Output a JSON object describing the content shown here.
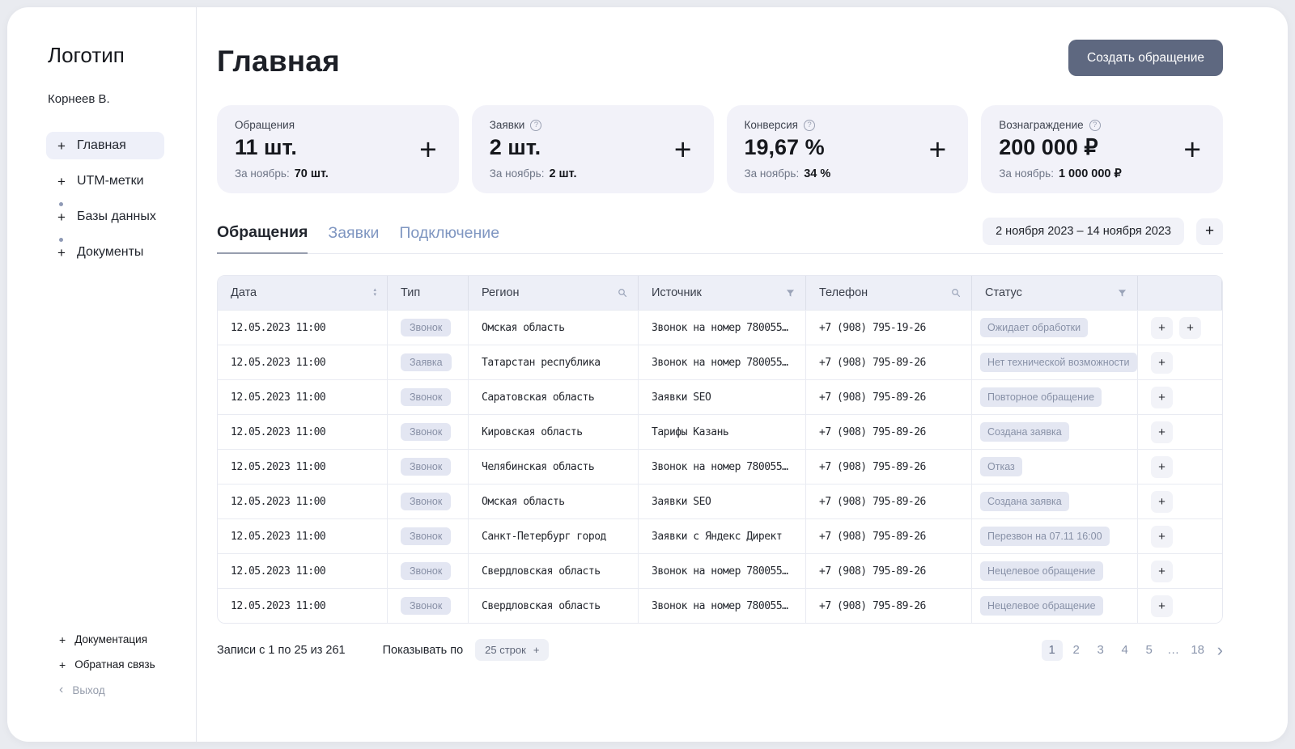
{
  "icons": {
    "plus": "+",
    "question": "?",
    "sort_up": "▴",
    "sort_down": "▾",
    "chevron_left": "‹",
    "chevron_right": "›",
    "ellipsis": "…"
  },
  "sidebar": {
    "logo": "Логотип",
    "user": "Корнеев В.",
    "items": [
      {
        "label": "Главная",
        "active": true
      },
      {
        "label": "UTM-метки"
      },
      {
        "label": "Базы данных",
        "dot": true
      },
      {
        "label": "Документы",
        "dot": true
      }
    ],
    "footer_items": [
      {
        "label": "Документация"
      },
      {
        "label": "Обратная связь"
      }
    ],
    "logout_label": "Выход"
  },
  "header": {
    "title": "Главная",
    "create_button_label": "Создать обращение"
  },
  "stats": [
    {
      "label": "Обращения",
      "help": false,
      "value": "11 шт.",
      "period_label": "За ноябрь:",
      "period_value": "70 шт."
    },
    {
      "label": "Заявки",
      "help": true,
      "value": "2 шт.",
      "period_label": "За ноябрь:",
      "period_value": "2 шт."
    },
    {
      "label": "Конверсия",
      "help": true,
      "value": "19,67 %",
      "period_label": "За ноябрь:",
      "period_value": "34 %"
    },
    {
      "label": "Вознаграждение",
      "help": true,
      "value": "200 000 ₽",
      "period_label": "За ноябрь:",
      "period_value": "1 000 000 ₽"
    }
  ],
  "tabs": [
    {
      "label": "Обращения",
      "active": true
    },
    {
      "label": "Заявки"
    },
    {
      "label": "Подключение"
    }
  ],
  "date_range": "2 ноября 2023 – 14 ноября 2023",
  "table": {
    "columns": [
      {
        "label": "Дата",
        "icon": "sort"
      },
      {
        "label": "Тип"
      },
      {
        "label": "Регион",
        "icon": "search"
      },
      {
        "label": "Источник",
        "icon": "filter"
      },
      {
        "label": "Телефон",
        "icon": "search"
      },
      {
        "label": "Статус",
        "icon": "filter"
      },
      {
        "label": ""
      }
    ],
    "rows": [
      {
        "date": "12.05.2023 11:00",
        "type": "Звонок",
        "region": "Омская область",
        "source": "Звонок на номер 780055…",
        "phone": "+7 (908) 795-19-26",
        "status": "Ожидает обработки",
        "actions": [
          "+",
          "+"
        ]
      },
      {
        "date": "12.05.2023 11:00",
        "type": "Заявка",
        "region": "Татарстан республика",
        "source": "Звонок на номер 780055…",
        "phone": "+7 (908) 795-89-26",
        "status": "Нет технической возможности",
        "actions": [
          "+"
        ]
      },
      {
        "date": "12.05.2023 11:00",
        "type": "Звонок",
        "region": "Саратовская область",
        "source": "Заявки SEO",
        "phone": "+7 (908) 795-89-26",
        "status": "Повторное обращение",
        "actions": [
          "+"
        ]
      },
      {
        "date": "12.05.2023 11:00",
        "type": "Звонок",
        "region": "Кировская область",
        "source": "Тарифы Казань",
        "phone": "+7 (908) 795-89-26",
        "status": "Создана заявка",
        "actions": [
          "+"
        ]
      },
      {
        "date": "12.05.2023 11:00",
        "type": "Звонок",
        "region": "Челябинская область",
        "source": "Звонок на номер 780055…",
        "phone": "+7 (908) 795-89-26",
        "status": "Отказ",
        "actions": [
          "+"
        ]
      },
      {
        "date": "12.05.2023 11:00",
        "type": "Звонок",
        "region": "Омская область",
        "source": "Заявки SEO",
        "phone": "+7 (908) 795-89-26",
        "status": "Создана заявка",
        "actions": [
          "+"
        ]
      },
      {
        "date": "12.05.2023 11:00",
        "type": "Звонок",
        "region": "Санкт-Петербург город",
        "source": "Заявки с Яндекс Директ",
        "phone": "+7 (908) 795-89-26",
        "status": "Перезвон на 07.11 16:00",
        "actions": [
          "+"
        ]
      },
      {
        "date": "12.05.2023 11:00",
        "type": "Звонок",
        "region": "Свердловская область",
        "source": "Звонок на номер 780055…",
        "phone": "+7 (908) 795-89-26",
        "status": "Нецелевое обращение",
        "actions": [
          "+"
        ]
      },
      {
        "date": "12.05.2023 11:00",
        "type": "Звонок",
        "region": "Свердловская область",
        "source": "Звонок на номер 780055…",
        "phone": "+7 (908) 795-89-26",
        "status": "Нецелевое обращение",
        "actions": [
          "+"
        ]
      }
    ]
  },
  "footer": {
    "records_info": "Записи с 1 по 25 из 261",
    "show_per_label": "Показывать по",
    "rows_per_page": "25 строк",
    "pages": [
      {
        "label": "1",
        "active": true
      },
      {
        "label": "2"
      },
      {
        "label": "3"
      },
      {
        "label": "4"
      },
      {
        "label": "5"
      },
      {
        "label": "…",
        "interactable": false
      },
      {
        "label": "18"
      }
    ]
  },
  "colors": {
    "accent_button": "#5e6880",
    "card_bg": "#f2f2f9",
    "badge_bg": "#e4e7f2",
    "badge_text": "#8891a7",
    "tab_inactive": "#7f96c1",
    "table_header_bg": "#edeff7"
  }
}
